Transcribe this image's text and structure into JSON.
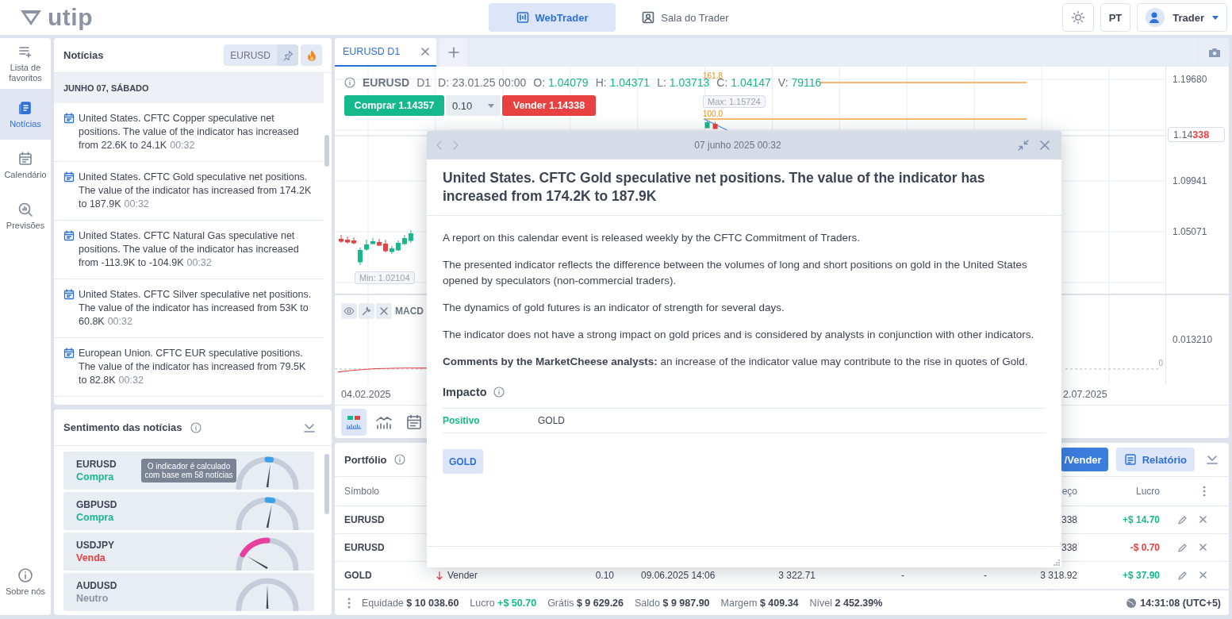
{
  "header": {
    "logo": "utip",
    "nav": [
      {
        "label": "WebTrader",
        "kind": "webtrader",
        "selected": true
      },
      {
        "label": "Sala do Trader",
        "kind": "room",
        "selected": false
      }
    ],
    "language": "PT",
    "user": "Trader"
  },
  "sidebar": {
    "items": [
      {
        "label": "Lista de favoritos",
        "kind": "watchlist",
        "selected": false
      },
      {
        "label": "Notícias",
        "kind": "news",
        "selected": true
      },
      {
        "label": "Calendário",
        "kind": "calendar",
        "selected": false
      },
      {
        "label": "Previsões",
        "kind": "forecast",
        "selected": false
      }
    ],
    "footer": {
      "label": "Sobre nós",
      "kind": "about"
    }
  },
  "news": {
    "title": "Notícias",
    "filter": "EURUSD",
    "date_header": "JUNHO 07, SÁBADO",
    "items": [
      {
        "text": "United States. CFTC Copper speculative net positions. The value of the indicator has increased from 22.6K to 24.1K",
        "time": "00:32"
      },
      {
        "text": "United States. CFTC Gold speculative net positions. The value of the indicator has increased from 174.2K to 187.9K",
        "time": "00:32"
      },
      {
        "text": "United States. CFTC Natural Gas speculative net positions. The value of the indicator has increased from -113.9K to -104.9K",
        "time": "00:32"
      },
      {
        "text": "United States. CFTC Silver speculative net positions. The value of the indicator has increased from 53K to 60.8K",
        "time": "00:32"
      },
      {
        "text": "European Union. CFTC EUR speculative positions. The value of the indicator has increased from 79.5K to 82.8K",
        "time": "00:32"
      }
    ]
  },
  "sentiment": {
    "title": "Sentimento das notícias",
    "tooltip": "O indicador é calculado com base em 58 notícias",
    "items": [
      {
        "symbol": "EURUSD",
        "label": "Compra",
        "kind": "buy",
        "level": 0.54
      },
      {
        "symbol": "GBPUSD",
        "label": "Compra",
        "kind": "buy",
        "level": 0.56
      },
      {
        "symbol": "USDJPY",
        "label": "Venda",
        "kind": "sell",
        "level": 0.17
      },
      {
        "symbol": "AUDUSD",
        "label": "Neutro",
        "kind": "neutral",
        "level": 0.5
      }
    ]
  },
  "chart": {
    "tab": {
      "label": "EURUSD D1",
      "selected": true
    },
    "symbol": "EURUSD",
    "timeframe": "D1",
    "fields": [
      {
        "label": "D:",
        "value": "23.01.25 00:00",
        "kind": "plain"
      },
      {
        "label": "O:",
        "value": "1.04079",
        "kind": "up"
      },
      {
        "label": "H:",
        "value": "1.04371",
        "kind": "up"
      },
      {
        "label": "L:",
        "value": "1.03713",
        "kind": "up"
      },
      {
        "label": "C:",
        "value": "1.04147",
        "kind": "up"
      },
      {
        "label": "V:",
        "value": "79116",
        "kind": "up"
      }
    ],
    "buy": "Comprar 1.14357",
    "quantity": "0.10",
    "sell": "Vender 1.14338",
    "levels": [
      "161.8",
      "100.0"
    ],
    "max": "Max: 1.15724",
    "min": "Min: 1.02104",
    "price_axis": [
      "1.19680",
      "1.09941",
      "1.05071"
    ],
    "current_price": "1.14**338**",
    "indicator": "MACD",
    "indicator_axis": "0.013210",
    "zero": "0",
    "dates": [
      "04.02.2025",
      "2.07.2025"
    ],
    "toolbar": [
      {
        "kind": "candles",
        "selected": true
      },
      {
        "kind": "line",
        "selected": false
      },
      {
        "kind": "calendar",
        "selected": false
      }
    ]
  },
  "modal": {
    "date": "07 junho 2025 00:32",
    "title": "United States. CFTC Gold speculative net positions. The value of the indicator has increased from 174.2K to 187.9K",
    "paragraphs": [
      "A report on this calendar event is released weekly by the CFTC Commitment of Traders.",
      "The presented indicator reflects the difference between the volumes of long and short positions on gold in the United States opened by speculators (non-commercial traders).",
      "The dynamics of gold futures is an indicator of strength for several days.",
      "The indicator does not have a strong impact on gold prices and is considered by analysts in conjunction with other indicators.",
      "**Comments by the MarketCheese analysts:** an increase of the indicator value may contribute to the rise in quotes of Gold."
    ],
    "impact_title": "Impacto",
    "impact": [
      {
        "label": "Positivo",
        "kind": "positive",
        "asset": "GOLD"
      }
    ],
    "tags": [
      "GOLD"
    ]
  },
  "portfolio": {
    "title": "Portfólio",
    "trade_button": "/Vender",
    "report_button": "Relatório",
    "columns": {
      "symbol": "Símbolo",
      "price": "eço",
      "profit": "Lucro"
    },
    "rows": [
      {
        "symbol": "EURUSD",
        "price": "338",
        "profit": "+$ 14.70",
        "loss": false
      },
      {
        "symbol": "EURUSD",
        "price": "338",
        "profit": "-$ 0.70",
        "loss": true
      },
      {
        "symbol": "GOLD",
        "sell": true,
        "side": "Vender",
        "volume": "0.10",
        "time": "09.06.2025 14:06",
        "open_price": "3 322.71",
        "stop_loss": "-",
        "take_profit": "-",
        "price": "3 318.92",
        "profit": "+$ 37.90",
        "loss": false
      }
    ]
  },
  "status_bar": {
    "items": [
      {
        "label": "Equidade",
        "value": "$ 10 038.60",
        "kind": "plain"
      },
      {
        "label": "Lucro",
        "value": "+$ 50.70",
        "kind": "up"
      },
      {
        "label": "Grátis",
        "value": "$ 9 629.26",
        "kind": "plain"
      },
      {
        "label": "Saldo",
        "value": "$ 9 987.90",
        "kind": "plain"
      },
      {
        "label": "Margem",
        "value": "$ 409.34",
        "kind": "plain"
      },
      {
        "label": "Nível",
        "value": "2 452.39%",
        "kind": "plain"
      }
    ],
    "time": "14:31:08 (UTC+5)"
  }
}
